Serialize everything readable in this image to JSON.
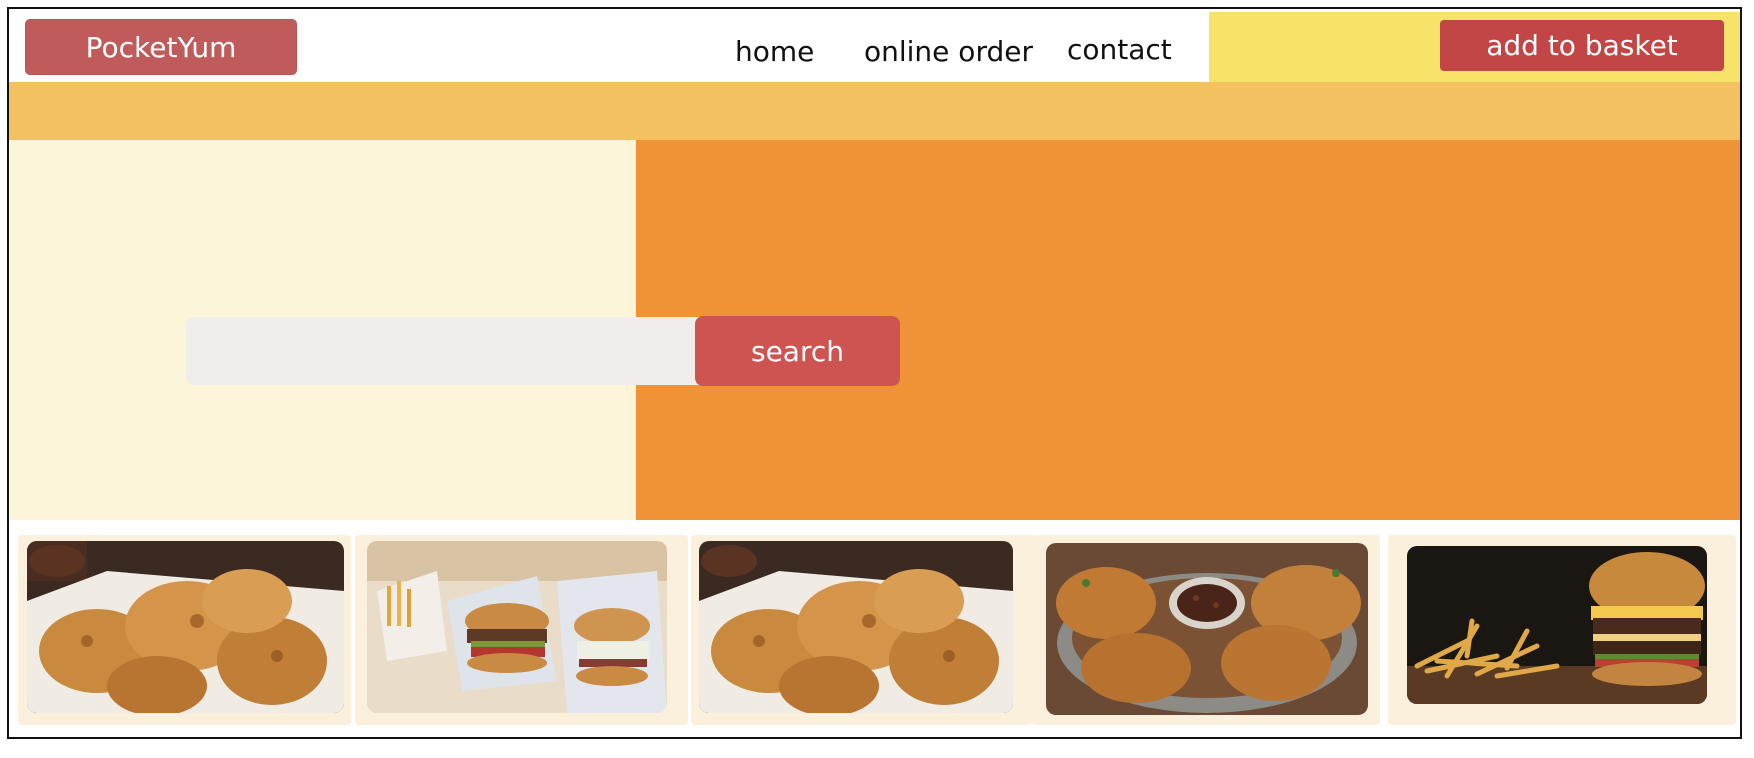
{
  "header": {
    "brand": "PocketYum",
    "nav": [
      "home",
      "online order",
      "contact"
    ],
    "basket_label": "add to basket"
  },
  "search": {
    "placeholder": "",
    "value": "",
    "button_label": "search"
  },
  "colors": {
    "brand_red": "#c05b5b",
    "accent_yellow": "#f8e36a",
    "band_orange": "#f4c160",
    "hero_cream": "#fdf5d9",
    "hero_orange": "#ef9336",
    "card_bg": "#fbf0dc"
  },
  "gallery": [
    {
      "name": "fried-chicken-photo"
    },
    {
      "name": "burgers-and-fries-photo"
    },
    {
      "name": "fried-chicken-photo"
    },
    {
      "name": "chicken-basket-with-sauce-photo"
    },
    {
      "name": "burger-and-fries-photo"
    }
  ]
}
